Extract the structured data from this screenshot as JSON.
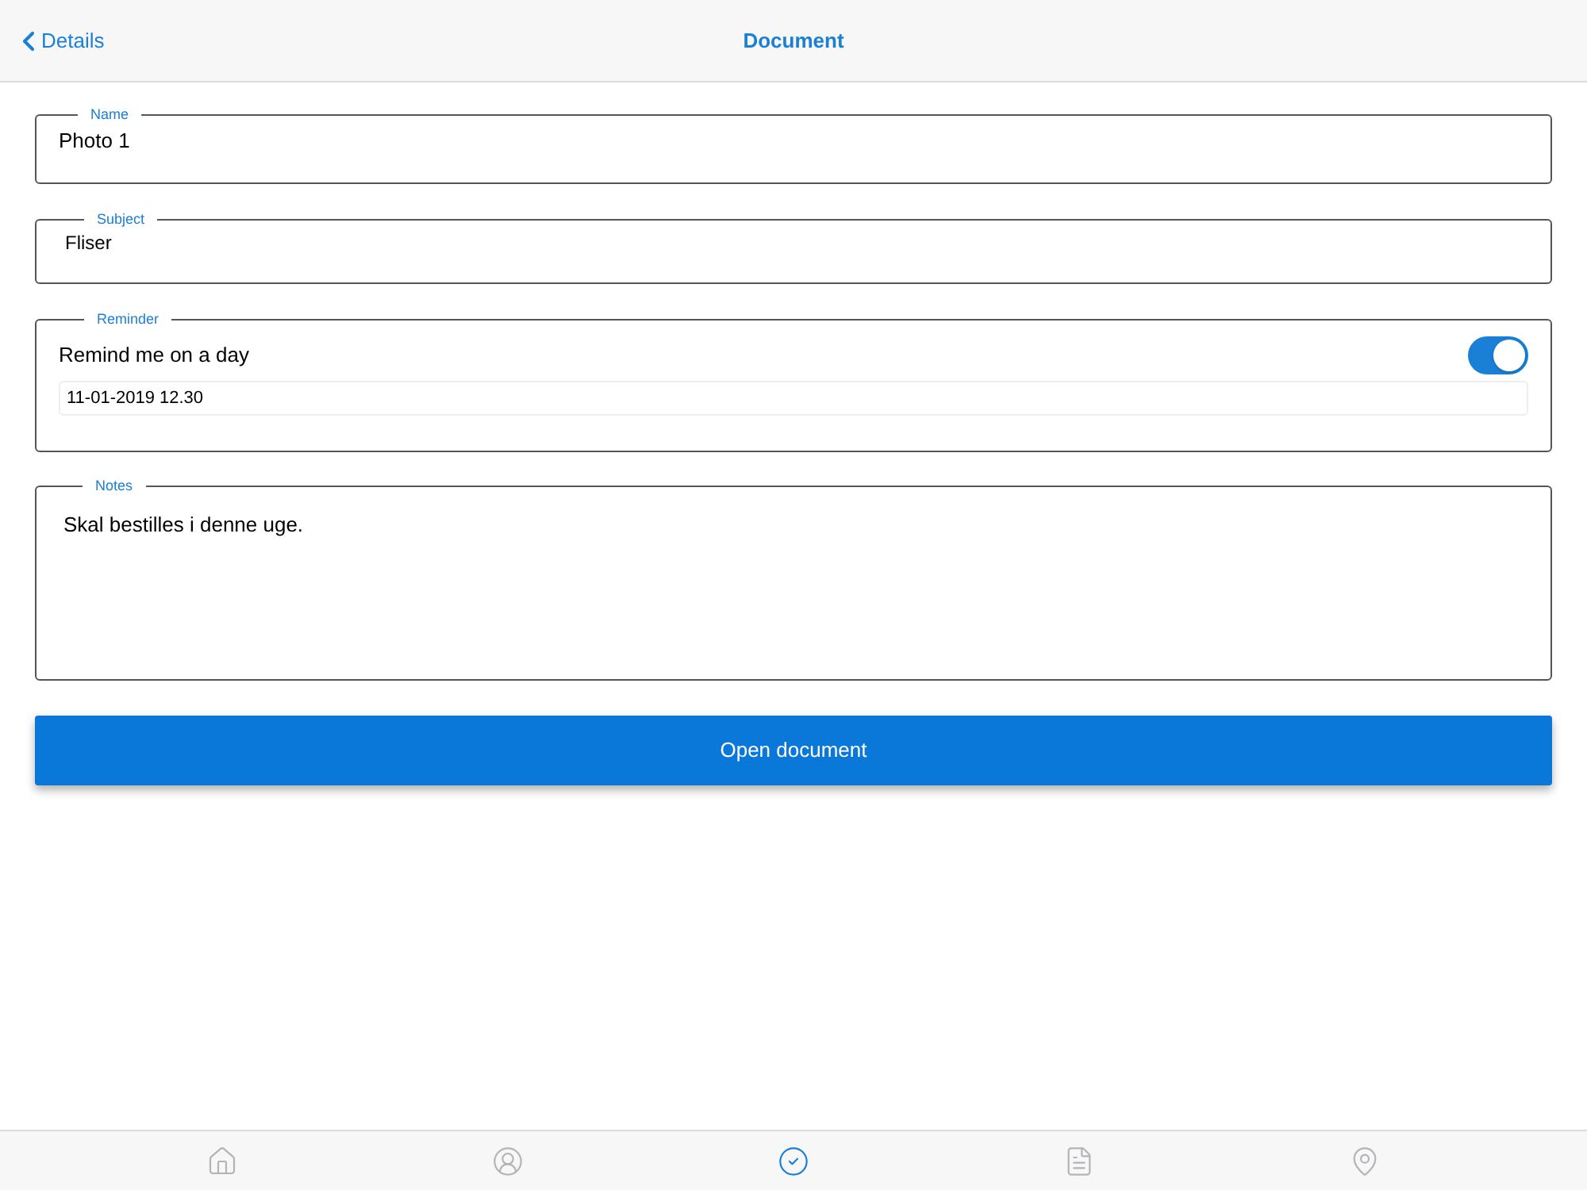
{
  "nav_bar": {
    "back_label": "Details",
    "title": "Document"
  },
  "name_field": {
    "label": "Name",
    "value": "Photo 1"
  },
  "subject_field": {
    "label": "Subject",
    "value": "Fliser"
  },
  "reminder": {
    "label": "Reminder",
    "toggle_label": "Remind me on a day",
    "on": true,
    "date_value": "11-01-2019 12.30"
  },
  "notes_field": {
    "label": "Notes",
    "value": "Skal bestilles i denne uge."
  },
  "open_button": "Open document",
  "tab_bar": [
    {
      "kind": "home",
      "selected": false
    },
    {
      "kind": "person",
      "selected": false
    },
    {
      "kind": "check",
      "selected": true
    },
    {
      "kind": "document",
      "selected": false
    },
    {
      "kind": "pin",
      "selected": false
    }
  ]
}
